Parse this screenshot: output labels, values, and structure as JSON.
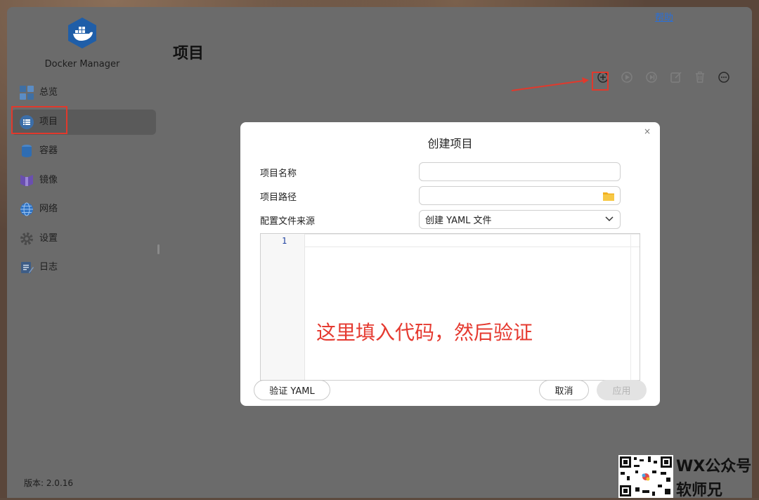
{
  "help_link": "帮助",
  "app": {
    "name": "Docker Manager",
    "version": "版本: 2.0.16"
  },
  "sidebar": {
    "items": [
      {
        "label": "总览",
        "icon": "overview-icon"
      },
      {
        "label": "项目",
        "icon": "list-icon",
        "active": true
      },
      {
        "label": "容器",
        "icon": "container-icon"
      },
      {
        "label": "镜像",
        "icon": "image-icon"
      },
      {
        "label": "网络",
        "icon": "network-icon"
      },
      {
        "label": "设置",
        "icon": "gear-icon"
      },
      {
        "label": "日志",
        "icon": "log-icon"
      }
    ]
  },
  "main": {
    "title": "项目",
    "toolbar": [
      "add-icon",
      "play-icon",
      "step-icon",
      "edit-icon",
      "trash-icon",
      "more-icon"
    ]
  },
  "dialog": {
    "title": "创建项目",
    "close": "×",
    "fields": {
      "name_label": "项目名称",
      "name_value": "",
      "path_label": "项目路径",
      "path_value": "",
      "source_label": "配置文件来源",
      "source_value": "创建 YAML 文件"
    },
    "editor": {
      "line_number": "1",
      "content": ""
    },
    "annotation": "这里填入代码，然后验证",
    "buttons": {
      "validate": "验证 YAML",
      "cancel": "取消",
      "apply": "应用"
    }
  },
  "watermark": {
    "line1": "WX公众号",
    "line2": "软师兄"
  },
  "colors": {
    "accent_red": "#e1392c",
    "link_blue": "#2b6fd6",
    "docker_blue": "#1f5ea8"
  }
}
